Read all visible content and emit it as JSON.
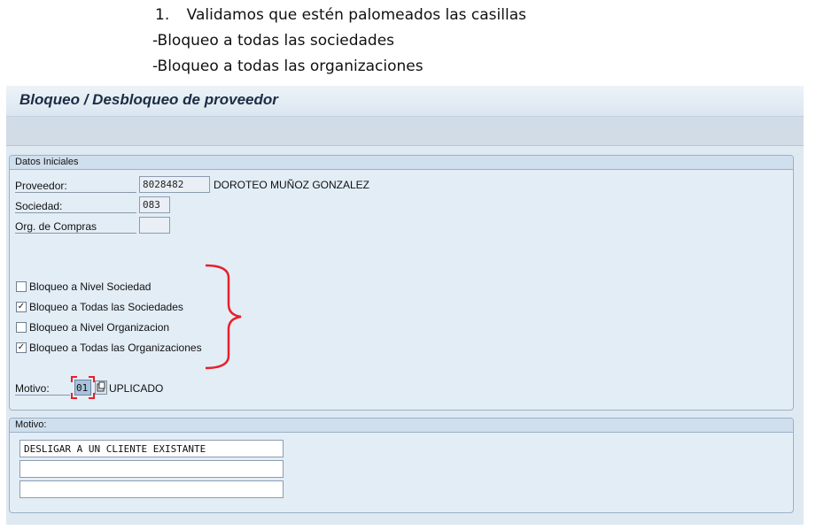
{
  "instructions": {
    "line1_number": "1.",
    "line1_text": "Validamos que estén palomeados las casillas",
    "line2": "-Bloqueo a todas las sociedades",
    "line3": "-Bloqueo a todas las organizaciones"
  },
  "window": {
    "title": "Bloqueo / Desbloqueo de proveedor"
  },
  "datos_iniciales": {
    "header": "Datos Iniciales",
    "proveedor_label": "Proveedor:",
    "proveedor_value": "8028482",
    "proveedor_name": "DOROTEO MUÑOZ GONZALEZ",
    "sociedad_label": "Sociedad:",
    "sociedad_value": "083",
    "org_compras_label": "Org. de Compras",
    "org_compras_value": ""
  },
  "checkboxes": [
    {
      "label": "Bloqueo a Nivel Sociedad",
      "checked": false
    },
    {
      "label": "Bloqueo a Todas las Sociedades",
      "checked": true
    },
    {
      "label": "Bloqueo a Nivel Organizacion",
      "checked": false
    },
    {
      "label": "Bloqueo a Todas las Organizaciones",
      "checked": true
    }
  ],
  "motivo_field": {
    "label": "Motivo:",
    "code": "01",
    "description": "UPLICADO"
  },
  "motivo_group": {
    "header": "Motivo:",
    "lines": [
      "DESLIGAR A UN CLIENTE EXISTANTE",
      "",
      ""
    ]
  },
  "colors": {
    "annotation_red": "#e8202a",
    "panel_bg": "#dfe9f2"
  }
}
